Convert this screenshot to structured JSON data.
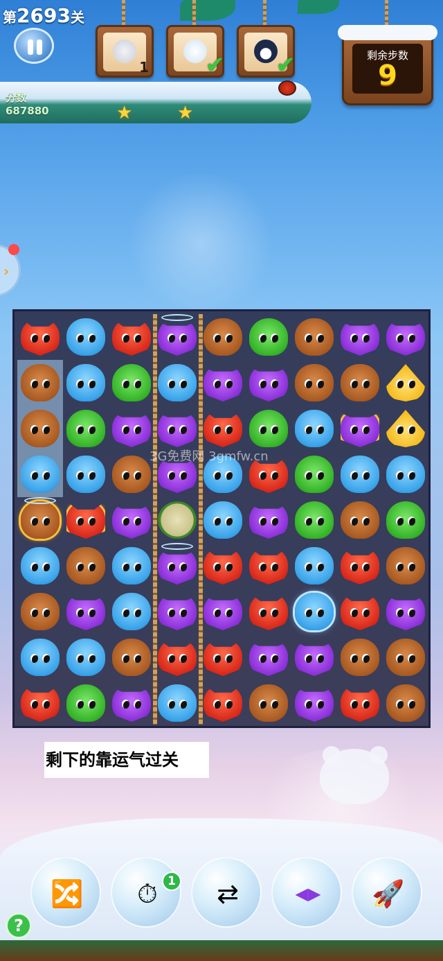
{
  "header": {
    "level_prefix": "第",
    "level_number": "2693",
    "level_suffix": "关",
    "score_label": "分数",
    "score_value": "687880",
    "stars_earned": 2
  },
  "goals": [
    {
      "animal": "seal",
      "count": "1",
      "done": false
    },
    {
      "animal": "polar-bear",
      "count": "",
      "done": true
    },
    {
      "animal": "penguin",
      "count": "",
      "done": true
    }
  ],
  "moves": {
    "label": "剩余步数",
    "value": "9"
  },
  "board": {
    "cols": 9,
    "rows": 9,
    "grid": [
      [
        "fox",
        "hippo",
        "fox",
        "owl",
        "bear",
        "frog",
        "bear",
        "owl",
        "owl"
      ],
      [
        "bear",
        "hippo",
        "frog",
        "hippo",
        "owl",
        "owl",
        "bear",
        "bear",
        "chick"
      ],
      [
        "bear",
        "frog",
        "owl",
        "owl",
        "fox",
        "frog",
        "hippo",
        "owl",
        "chick"
      ],
      [
        "hippo",
        "hippo",
        "bear",
        "owl",
        "hippo",
        "fox",
        "frog",
        "hippo",
        "hippo"
      ],
      [
        "bear",
        "fox",
        "owl",
        "leaf",
        "hippo",
        "owl",
        "frog",
        "bear",
        "frog"
      ],
      [
        "hippo",
        "bear",
        "hippo",
        "owl",
        "fox",
        "fox",
        "hippo",
        "fox",
        "bear"
      ],
      [
        "bear",
        "owl",
        "hippo",
        "owl",
        "owl",
        "fox",
        "hippo",
        "fox",
        "owl"
      ],
      [
        "hippo",
        "hippo",
        "bear",
        "fox",
        "fox",
        "owl",
        "owl",
        "bear",
        "bear"
      ],
      [
        "fox",
        "frog",
        "owl",
        "hippo",
        "fox",
        "bear",
        "owl",
        "fox",
        "bear"
      ]
    ],
    "watermark": "3G免费网 3gmfw.cn"
  },
  "caption": "剩下的靠运气过关",
  "boosters": [
    {
      "name": "shuffle",
      "icon": "🔀",
      "count": ""
    },
    {
      "name": "extra-time",
      "icon": "⏱",
      "count": "1"
    },
    {
      "name": "swap",
      "icon": "⇄",
      "count": ""
    },
    {
      "name": "line-clear",
      "icon": "◀▶",
      "count": ""
    },
    {
      "name": "rocket",
      "icon": "🚀",
      "count": ""
    }
  ],
  "help_label": "?",
  "colors": {
    "accent": "#ffd81c",
    "board_bg": "#282a46",
    "check": "#3ec43e"
  }
}
